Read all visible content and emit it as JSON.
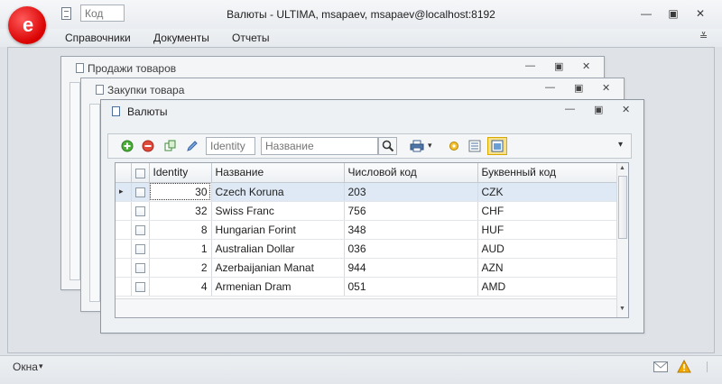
{
  "titlebar": {
    "logo_letter": "e",
    "code_placeholder": "Код",
    "title": "Валюты - ULTIMA, msapaev, msapaev@localhost:8192",
    "minimize": "—",
    "restore": "▣",
    "close": "✕"
  },
  "menu": {
    "items": [
      "Справочники",
      "Документы",
      "Отчеты"
    ],
    "chevron": "≚"
  },
  "windows": {
    "sales": {
      "title": "Продажи товаров"
    },
    "purchases": {
      "title": "Закупки товара"
    },
    "currencies": {
      "title": "Валюты"
    },
    "ctrl_min": "—",
    "ctrl_restore": "▣",
    "ctrl_close": "✕"
  },
  "toolbar": {
    "identity_placeholder": "Identity",
    "name_placeholder": "Название",
    "icons": {
      "add": "plus-circle-icon",
      "delete": "minus-circle-icon",
      "copy": "copy-icon",
      "edit": "pencil-icon",
      "search": "magnifier-icon",
      "print": "printer-icon",
      "settings": "gear-icon",
      "columns": "list-columns-icon",
      "layout": "layout-icon"
    },
    "overflow": "▾"
  },
  "grid": {
    "columns": [
      "Identity",
      "Название",
      "Числовой код",
      "Буквенный код"
    ],
    "rows": [
      {
        "identity": "30",
        "name": "Czech Koruna",
        "num": "203",
        "alpha": "CZK"
      },
      {
        "identity": "32",
        "name": "Swiss Franc",
        "num": "756",
        "alpha": "CHF"
      },
      {
        "identity": "8",
        "name": "Hungarian Forint",
        "num": "348",
        "alpha": "HUF"
      },
      {
        "identity": "1",
        "name": "Australian Dollar",
        "num": "036",
        "alpha": "AUD"
      },
      {
        "identity": "2",
        "name": "Azerbaijanian Manat",
        "num": "944",
        "alpha": "AZN"
      },
      {
        "identity": "4",
        "name": "Armenian Dram",
        "num": "051",
        "alpha": "AMD"
      }
    ],
    "row_indicator": "▸",
    "scroll_up": "▲",
    "scroll_down": "▼"
  },
  "statusbar": {
    "windows_label": "Окна",
    "windows_arrow": "▾",
    "icons": {
      "mail": "envelope-icon",
      "warning": "warning-icon"
    }
  },
  "colors": {
    "logo_red": "#e30000",
    "warning": "#f2a900",
    "selection": "#dfe9f5"
  }
}
